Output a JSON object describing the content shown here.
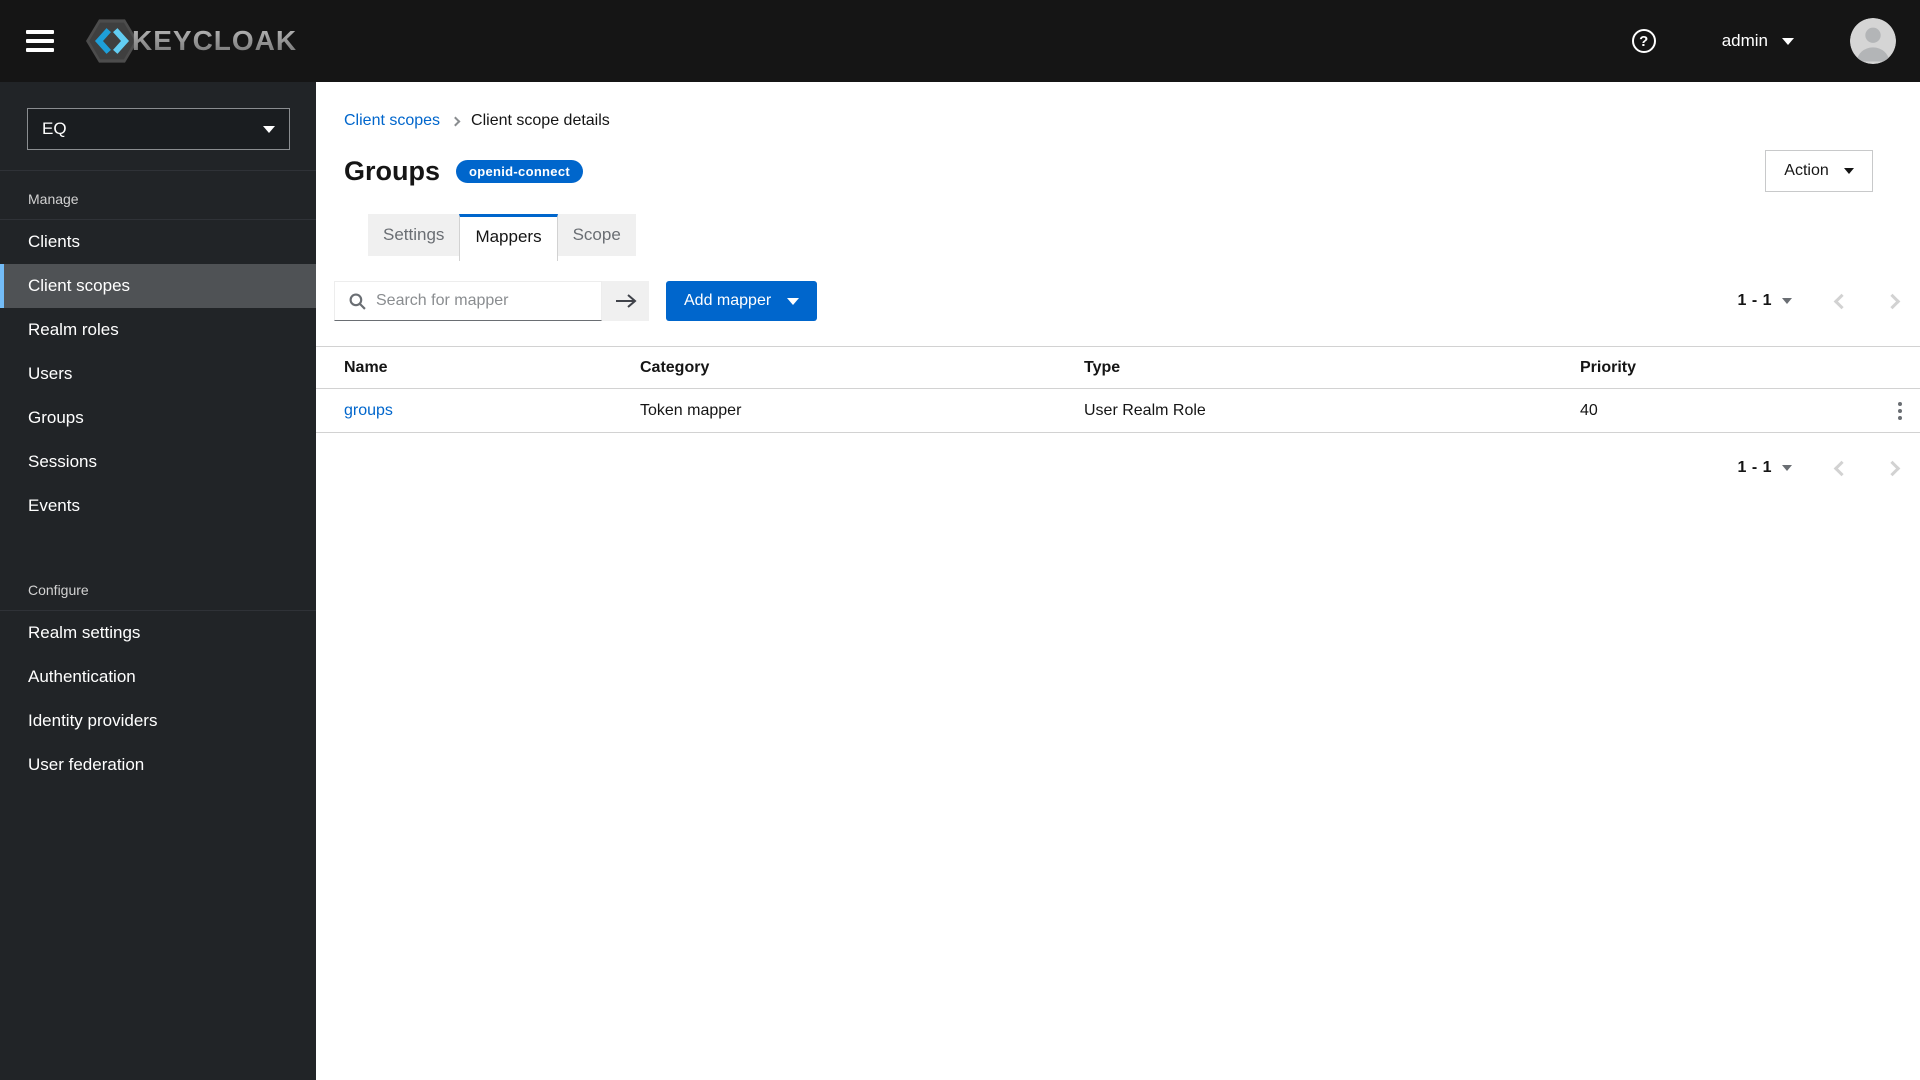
{
  "masthead": {
    "brand": "KEYCLOAK",
    "user": "admin"
  },
  "icons": {
    "help": "?",
    "hamburger": "menu",
    "search": "magnifier",
    "arrow_right": "→",
    "kebab": "vertical-dots"
  },
  "sidebar": {
    "realm": "EQ",
    "sections": [
      {
        "label": "Manage",
        "items": [
          {
            "label": "Clients"
          },
          {
            "label": "Client scopes",
            "active": true
          },
          {
            "label": "Realm roles"
          },
          {
            "label": "Users"
          },
          {
            "label": "Groups"
          },
          {
            "label": "Sessions"
          },
          {
            "label": "Events"
          }
        ]
      },
      {
        "label": "Configure",
        "items": [
          {
            "label": "Realm settings"
          },
          {
            "label": "Authentication"
          },
          {
            "label": "Identity providers"
          },
          {
            "label": "User federation"
          }
        ]
      }
    ]
  },
  "breadcrumb": {
    "link": "Client scopes",
    "current": "Client scope details"
  },
  "page": {
    "title": "Groups",
    "badge": "openid-connect",
    "action_label": "Action"
  },
  "tabs": [
    {
      "label": "Settings"
    },
    {
      "label": "Mappers",
      "active": true
    },
    {
      "label": "Scope"
    }
  ],
  "toolbar": {
    "search_placeholder": "Search for mapper",
    "search_value": "",
    "add_button": "Add mapper"
  },
  "pagination": {
    "top": "1 - 1",
    "bottom": "1 - 1"
  },
  "table": {
    "columns": [
      "Name",
      "Category",
      "Type",
      "Priority"
    ],
    "rows": [
      {
        "name": "groups",
        "category": "Token mapper",
        "type": "User Realm Role",
        "priority": "40"
      }
    ]
  },
  "colors": {
    "accent_blue": "#0066cc",
    "nav_active_border": "#73bcf7",
    "masthead_bg": "#151515",
    "sidebar_bg": "#212427",
    "tab_inactive_bg": "#f0f0f0",
    "muted_text": "#6a6e73"
  }
}
